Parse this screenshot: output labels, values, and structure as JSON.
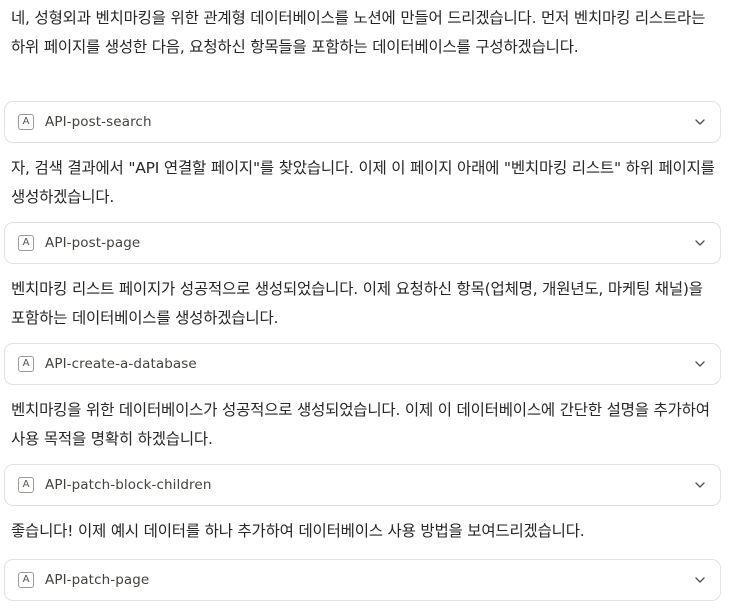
{
  "messages": [
    {
      "text": "네, 성형외과 벤치마킹을 위한 관계형 데이터베이스를 노션에 만들어 드리겠습니다. 먼저 벤치마킹 리스트라는 하위 페이지를 생성한 다음, 요청하신 항목들을 포함하는 데이터베이스를 구성하겠습니다.",
      "tool": {
        "icon_letter": "A",
        "icon": "tool-a-icon",
        "name": "API-post-search",
        "chevron": "chevron-down-icon"
      }
    },
    {
      "text": "자, 검색 결과에서 \"API 연결할 페이지\"를 찾았습니다. 이제 이 페이지 아래에 \"벤치마킹 리스트\" 하위 페이지를 생성하겠습니다.",
      "tool": {
        "icon_letter": "A",
        "icon": "tool-a-icon",
        "name": "API-post-page",
        "chevron": "chevron-down-icon"
      }
    },
    {
      "text": "벤치마킹 리스트 페이지가 성공적으로 생성되었습니다. 이제 요청하신 항목(업체명, 개원년도, 마케팅 채널)을 포함하는 데이터베이스를 생성하겠습니다.",
      "tool": {
        "icon_letter": "A",
        "icon": "tool-a-icon",
        "name": "API-create-a-database",
        "chevron": "chevron-down-icon"
      }
    },
    {
      "text": "벤치마킹을 위한 데이터베이스가 성공적으로 생성되었습니다. 이제 이 데이터베이스에 간단한 설명을 추가하여 사용 목적을 명확히 하겠습니다.",
      "tool": {
        "icon_letter": "A",
        "icon": "tool-a-icon",
        "name": "API-patch-block-children",
        "chevron": "chevron-down-icon"
      }
    },
    {
      "text": "좋습니다! 이제 예시 데이터를 하나 추가하여 데이터베이스 사용 방법을 보여드리겠습니다.",
      "tool": {
        "icon_letter": "A",
        "icon": "tool-a-icon",
        "name": "API-patch-page",
        "chevron": "chevron-down-icon"
      }
    }
  ]
}
